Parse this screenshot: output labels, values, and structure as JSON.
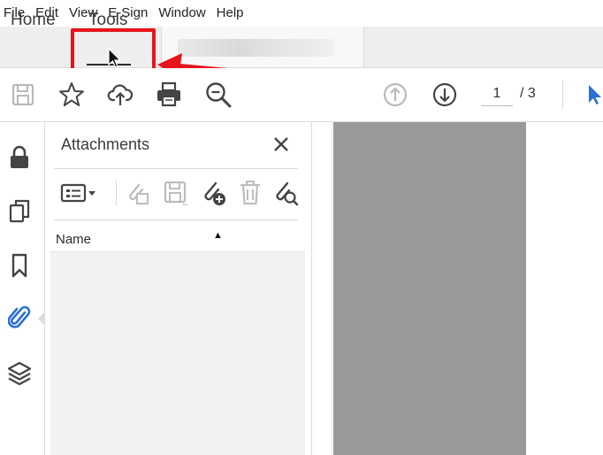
{
  "menu": {
    "items": [
      "File",
      "Edit",
      "View",
      "E-Sign",
      "Window",
      "Help"
    ]
  },
  "tabs": {
    "home_label": "Home",
    "tools_label": "Tools"
  },
  "toolbar": {
    "icons": [
      "save-icon",
      "star-icon",
      "cloud-upload-icon",
      "print-icon",
      "zoom-search-icon",
      "page-up-icon",
      "page-down-icon",
      "select-cursor-icon"
    ],
    "current_page": "1",
    "total_pages": "/ 3"
  },
  "sidebar": {
    "icons": [
      "lock-icon",
      "pages-icon",
      "bookmark-icon",
      "paperclip-icon",
      "layers-icon"
    ]
  },
  "attachments": {
    "title": "Attachments",
    "tool_icons": [
      "list-options-icon",
      "open-attachment-icon",
      "save-attachment-icon",
      "add-attachment-icon",
      "delete-icon",
      "search-attachment-icon"
    ],
    "column_header": "Name",
    "sort_indicator": "▲"
  },
  "colors": {
    "accent_blue": "#2a6fd6",
    "annotation_red": "#e8141b",
    "doc_gray": "#999999"
  }
}
